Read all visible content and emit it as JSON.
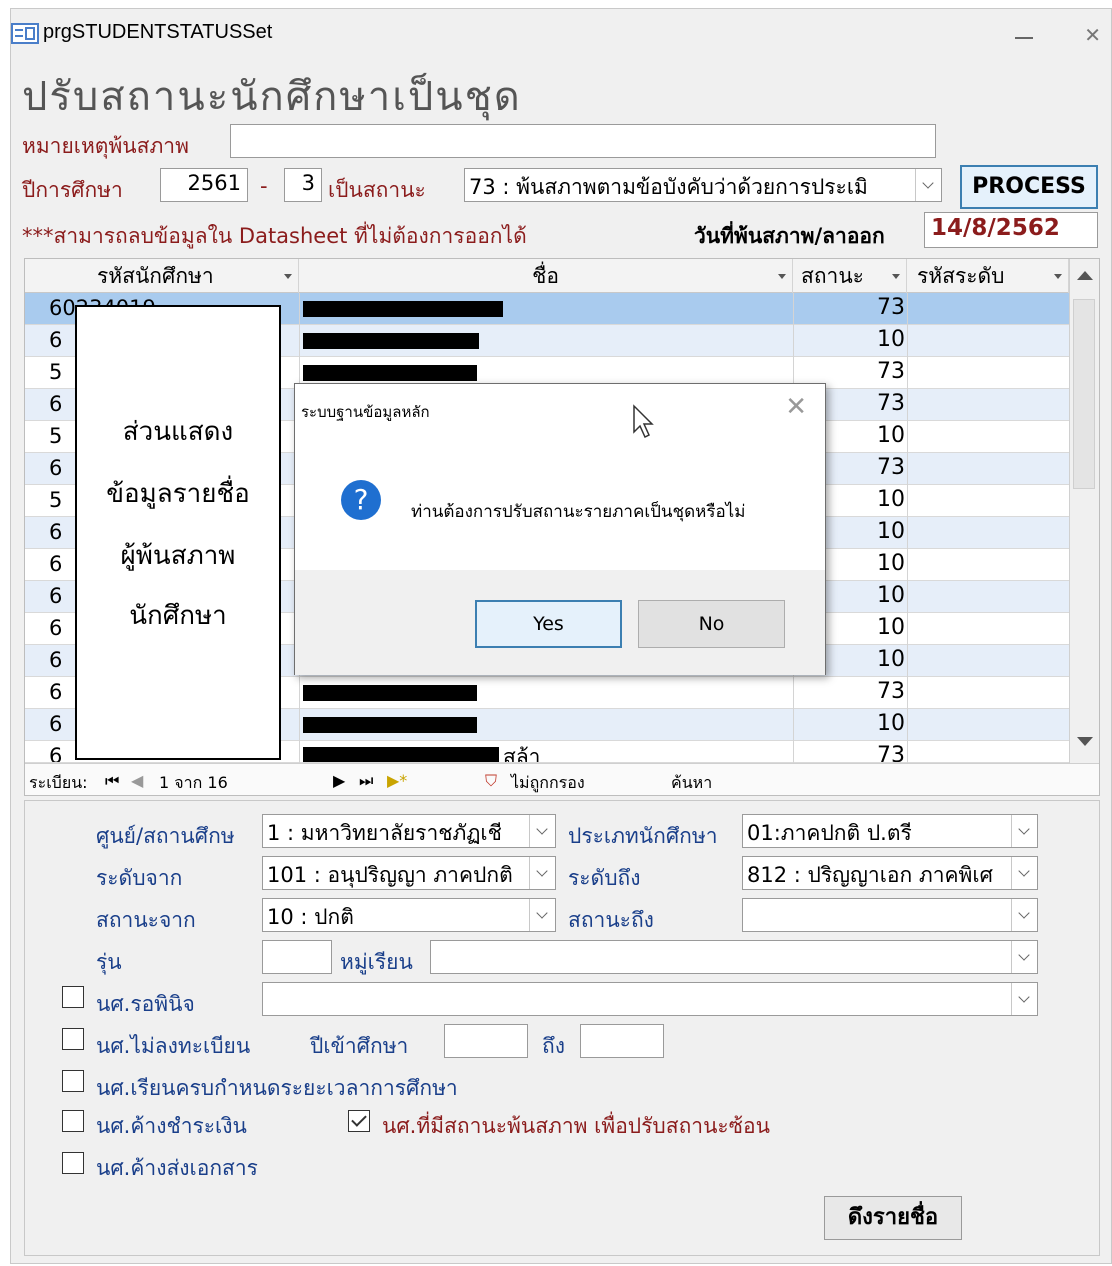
{
  "window": {
    "title": "prgSTUDENTSTATUSSet"
  },
  "page_title": "ปรับสถานะนักศึกษาเป็นชุด",
  "top_form": {
    "remark_label": "หมายเหตุพ้นสภาพ",
    "remark_value": "",
    "year_label": "ปีการศึกษา",
    "year_value": "2561",
    "dash": "-",
    "term_value": "3",
    "status_to_label": "เป็นสถานะ",
    "status_to_value": "73 : พ้นสภาพตามข้อบังคับว่าด้วยการประเมิ",
    "process_label": "PROCESS",
    "note": "***สามารถลบข้อมูลใน Datasheet ที่ไม่ต้องการออกได้",
    "date_label": "วันที่พ้นสภาพ/ลาออก",
    "date_value": "14/8/2562"
  },
  "grid": {
    "columns": [
      "รหัสนักศึกษา",
      "ชื่อ",
      "สถานะ",
      "รหัสระดับ"
    ],
    "rows": [
      {
        "id": "60234019",
        "status": "73"
      },
      {
        "id": "6",
        "status": "10"
      },
      {
        "id": "5",
        "status": "73"
      },
      {
        "id": "6",
        "status": "73"
      },
      {
        "id": "5",
        "status": "10"
      },
      {
        "id": "6",
        "status": "73"
      },
      {
        "id": "5",
        "status": "10"
      },
      {
        "id": "6",
        "status": "10"
      },
      {
        "id": "6",
        "status": "10"
      },
      {
        "id": "6",
        "status": "10"
      },
      {
        "id": "6",
        "status": "10"
      },
      {
        "id": "6",
        "status": "10"
      },
      {
        "id": "6",
        "status": "73"
      },
      {
        "id": "6",
        "status": "10"
      },
      {
        "id": "6",
        "status": "73"
      }
    ],
    "last_row_suffix": "สล้า",
    "nav": {
      "record_label": "ระเบียน:",
      "position": "1 จาก 16",
      "filter_label": "ไม่ถูกกรอง",
      "search_label": "ค้นหา"
    }
  },
  "overlay_note": [
    "ส่วนแสดง",
    "ข้อมูลรายชื่อ",
    "ผู้พ้นสภาพ",
    "นักศึกษา"
  ],
  "dialog": {
    "title": "ระบบฐานข้อมูลหลัก",
    "message": "ท่านต้องการปรับสถานะรายภาคเป็นชุดหรือไม่",
    "yes_label": "Yes",
    "no_label": "No",
    "icon": "question-icon"
  },
  "filter": {
    "center_label": "ศูนย์/สถานศึกษ",
    "center_value": "1 : มหาวิทยาลัยราชภัฏเชี",
    "student_type_label": "ประเภทนักศึกษา",
    "student_type_value": "01:ภาคปกติ ป.ตรี",
    "level_from_label": "ระดับจาก",
    "level_from_value": "101 : อนุปริญญา ภาคปกติ",
    "level_to_label": "ระดับถึง",
    "level_to_value": "812 : ปริญญาเอก ภาคพิเศ",
    "status_from_label": "สถานะจาก",
    "status_from_value": "10 : ปกติ",
    "status_to_label": "สถานะถึง",
    "status_to_value": "",
    "batch_label": "รุ่น",
    "batch_value": "",
    "group_label": "หมู่เรียน",
    "group_value": "",
    "pending_label": "นศ.รอพินิจ",
    "pending_value": "",
    "unregistered_label": "นศ.ไม่ลงทะเบียน",
    "entry_year_label": "ปีเข้าศึกษา",
    "entry_year_from": "",
    "to_label": "ถึง",
    "entry_year_to": "",
    "complete_term_label": "นศ.เรียนครบกำหนดระยะเวลาการศึกษา",
    "unpaid_label": "นศ.ค้างชำระเงิน",
    "overlap_label": "นศ.ที่มีสถานะพ้นสภาพ เพื่อปรับสถานะซ้อน",
    "missing_docs_label": "นศ.ค้างส่งเอกสาร",
    "checkbox_states": {
      "pending": false,
      "unregistered": false,
      "complete_term": false,
      "unpaid": false,
      "overlap": true,
      "missing_docs": false
    },
    "get_names_label": "ดึงรายชื่อ"
  },
  "colors": {
    "dark_red": "#8b1c1c",
    "blue_label": "#1a3f8a",
    "accent": "#3c7fb1",
    "selected_row": "#a9cbee",
    "alt_row": "#e6eef9"
  }
}
